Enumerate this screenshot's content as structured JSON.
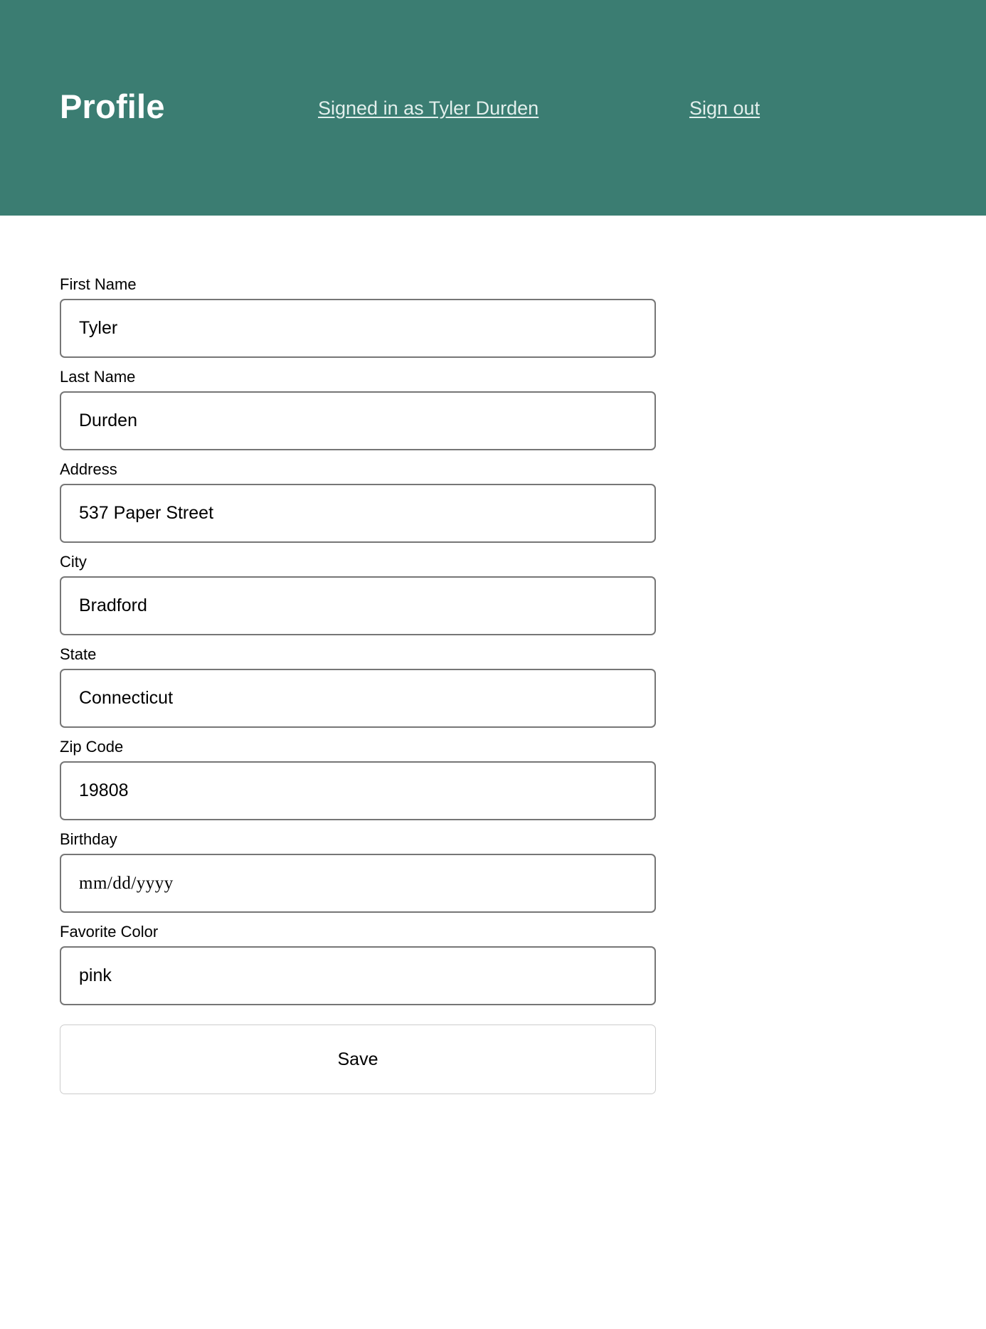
{
  "header": {
    "title": "Profile",
    "signed_in_text": "Signed in as Tyler Durden",
    "sign_out_label": "Sign out",
    "background_color": "#3b7d72",
    "title_color": "#ffffff",
    "link_color": "#e2efec"
  },
  "form": {
    "fields": [
      {
        "label": "First Name",
        "value": "Tyler",
        "placeholder": ""
      },
      {
        "label": "Last Name",
        "value": "Durden",
        "placeholder": ""
      },
      {
        "label": "Address",
        "value": "537 Paper Street",
        "placeholder": ""
      },
      {
        "label": "City",
        "value": "Bradford",
        "placeholder": ""
      },
      {
        "label": "State",
        "value": "Connecticut",
        "placeholder": ""
      },
      {
        "label": "Zip Code",
        "value": "19808",
        "placeholder": ""
      },
      {
        "label": "Birthday",
        "value": "",
        "placeholder": "mm/dd/yyyy"
      },
      {
        "label": "Favorite Color",
        "value": "pink",
        "placeholder": ""
      }
    ],
    "save_label": "Save",
    "input_border_color": "#767676",
    "button_border_color": "#cccccc"
  }
}
